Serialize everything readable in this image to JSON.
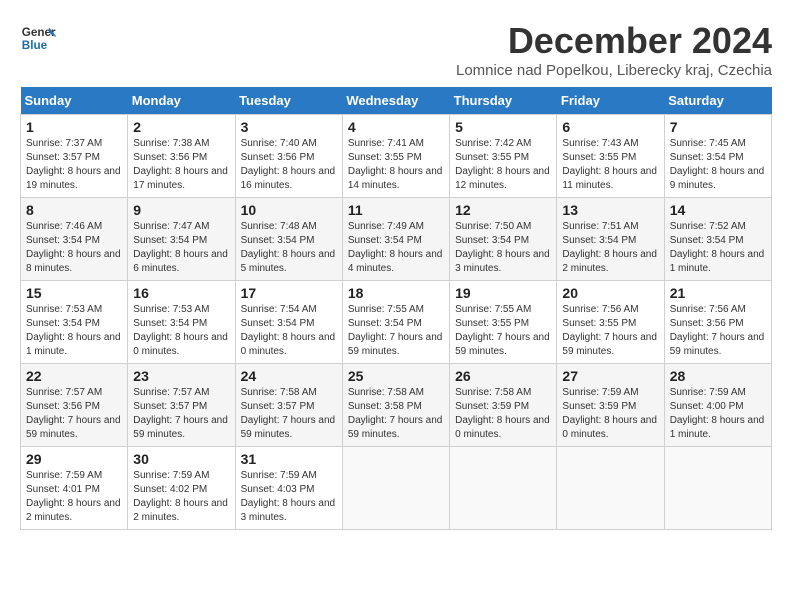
{
  "header": {
    "logo_general": "General",
    "logo_blue": "Blue",
    "month_title": "December 2024",
    "location": "Lomnice nad Popelkou, Liberecky kraj, Czechia"
  },
  "calendar": {
    "days_of_week": [
      "Sunday",
      "Monday",
      "Tuesday",
      "Wednesday",
      "Thursday",
      "Friday",
      "Saturday"
    ],
    "weeks": [
      [
        {
          "num": "",
          "info": ""
        },
        {
          "num": "2",
          "info": "Sunrise: 7:38 AM\nSunset: 3:56 PM\nDaylight: 8 hours and 17 minutes."
        },
        {
          "num": "3",
          "info": "Sunrise: 7:40 AM\nSunset: 3:56 PM\nDaylight: 8 hours and 16 minutes."
        },
        {
          "num": "4",
          "info": "Sunrise: 7:41 AM\nSunset: 3:55 PM\nDaylight: 8 hours and 14 minutes."
        },
        {
          "num": "5",
          "info": "Sunrise: 7:42 AM\nSunset: 3:55 PM\nDaylight: 8 hours and 12 minutes."
        },
        {
          "num": "6",
          "info": "Sunrise: 7:43 AM\nSunset: 3:55 PM\nDaylight: 8 hours and 11 minutes."
        },
        {
          "num": "7",
          "info": "Sunrise: 7:45 AM\nSunset: 3:54 PM\nDaylight: 8 hours and 9 minutes."
        }
      ],
      [
        {
          "num": "8",
          "info": "Sunrise: 7:46 AM\nSunset: 3:54 PM\nDaylight: 8 hours and 8 minutes."
        },
        {
          "num": "9",
          "info": "Sunrise: 7:47 AM\nSunset: 3:54 PM\nDaylight: 8 hours and 6 minutes."
        },
        {
          "num": "10",
          "info": "Sunrise: 7:48 AM\nSunset: 3:54 PM\nDaylight: 8 hours and 5 minutes."
        },
        {
          "num": "11",
          "info": "Sunrise: 7:49 AM\nSunset: 3:54 PM\nDaylight: 8 hours and 4 minutes."
        },
        {
          "num": "12",
          "info": "Sunrise: 7:50 AM\nSunset: 3:54 PM\nDaylight: 8 hours and 3 minutes."
        },
        {
          "num": "13",
          "info": "Sunrise: 7:51 AM\nSunset: 3:54 PM\nDaylight: 8 hours and 2 minutes."
        },
        {
          "num": "14",
          "info": "Sunrise: 7:52 AM\nSunset: 3:54 PM\nDaylight: 8 hours and 1 minute."
        }
      ],
      [
        {
          "num": "15",
          "info": "Sunrise: 7:53 AM\nSunset: 3:54 PM\nDaylight: 8 hours and 1 minute."
        },
        {
          "num": "16",
          "info": "Sunrise: 7:53 AM\nSunset: 3:54 PM\nDaylight: 8 hours and 0 minutes."
        },
        {
          "num": "17",
          "info": "Sunrise: 7:54 AM\nSunset: 3:54 PM\nDaylight: 8 hours and 0 minutes."
        },
        {
          "num": "18",
          "info": "Sunrise: 7:55 AM\nSunset: 3:54 PM\nDaylight: 7 hours and 59 minutes."
        },
        {
          "num": "19",
          "info": "Sunrise: 7:55 AM\nSunset: 3:55 PM\nDaylight: 7 hours and 59 minutes."
        },
        {
          "num": "20",
          "info": "Sunrise: 7:56 AM\nSunset: 3:55 PM\nDaylight: 7 hours and 59 minutes."
        },
        {
          "num": "21",
          "info": "Sunrise: 7:56 AM\nSunset: 3:56 PM\nDaylight: 7 hours and 59 minutes."
        }
      ],
      [
        {
          "num": "22",
          "info": "Sunrise: 7:57 AM\nSunset: 3:56 PM\nDaylight: 7 hours and 59 minutes."
        },
        {
          "num": "23",
          "info": "Sunrise: 7:57 AM\nSunset: 3:57 PM\nDaylight: 7 hours and 59 minutes."
        },
        {
          "num": "24",
          "info": "Sunrise: 7:58 AM\nSunset: 3:57 PM\nDaylight: 7 hours and 59 minutes."
        },
        {
          "num": "25",
          "info": "Sunrise: 7:58 AM\nSunset: 3:58 PM\nDaylight: 7 hours and 59 minutes."
        },
        {
          "num": "26",
          "info": "Sunrise: 7:58 AM\nSunset: 3:59 PM\nDaylight: 8 hours and 0 minutes."
        },
        {
          "num": "27",
          "info": "Sunrise: 7:59 AM\nSunset: 3:59 PM\nDaylight: 8 hours and 0 minutes."
        },
        {
          "num": "28",
          "info": "Sunrise: 7:59 AM\nSunset: 4:00 PM\nDaylight: 8 hours and 1 minute."
        }
      ],
      [
        {
          "num": "29",
          "info": "Sunrise: 7:59 AM\nSunset: 4:01 PM\nDaylight: 8 hours and 2 minutes."
        },
        {
          "num": "30",
          "info": "Sunrise: 7:59 AM\nSunset: 4:02 PM\nDaylight: 8 hours and 2 minutes."
        },
        {
          "num": "31",
          "info": "Sunrise: 7:59 AM\nSunset: 4:03 PM\nDaylight: 8 hours and 3 minutes."
        },
        {
          "num": "",
          "info": ""
        },
        {
          "num": "",
          "info": ""
        },
        {
          "num": "",
          "info": ""
        },
        {
          "num": "",
          "info": ""
        }
      ]
    ],
    "week0_day1": {
      "num": "1",
      "info": "Sunrise: 7:37 AM\nSunset: 3:57 PM\nDaylight: 8 hours and 19 minutes."
    }
  }
}
